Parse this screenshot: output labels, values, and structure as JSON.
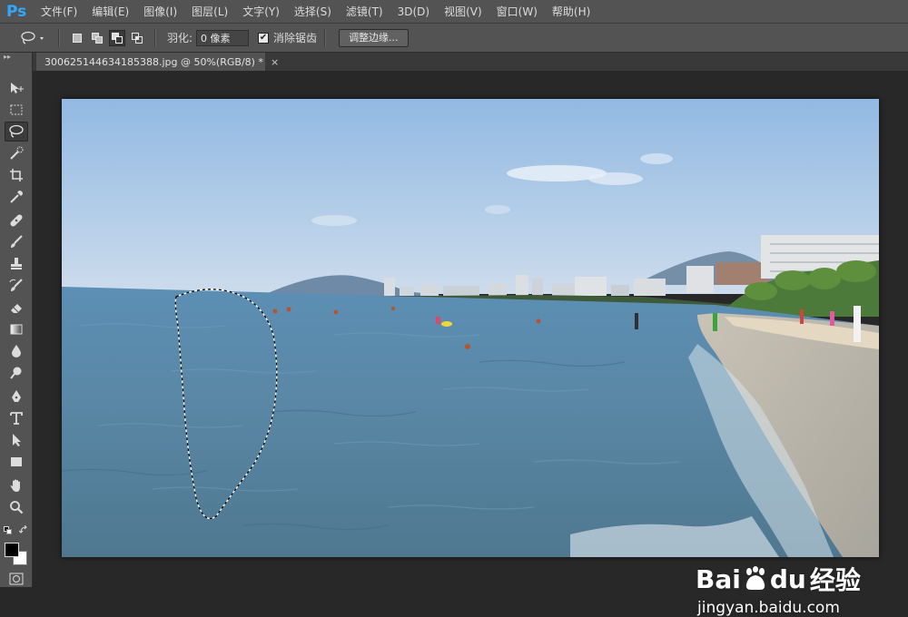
{
  "app": {
    "logo": "Ps"
  },
  "menu": [
    "文件(F)",
    "编辑(E)",
    "图像(I)",
    "图层(L)",
    "文字(Y)",
    "选择(S)",
    "滤镜(T)",
    "3D(D)",
    "视图(V)",
    "窗口(W)",
    "帮助(H)"
  ],
  "options": {
    "tool_icon": "lasso-icon",
    "feather_label": "羽化:",
    "feather_value": "0 像素",
    "antialias_checked": true,
    "antialias_label": "消除锯齿",
    "refine_edge_label": "调整边缘..."
  },
  "document": {
    "tab_title": "300625144634185388.jpg @ 50%(RGB/8) *",
    "close_glyph": "×"
  },
  "tools": [
    "move-tool",
    "marquee-tool",
    "lasso-tool",
    "quick-selection-tool",
    "crop-tool",
    "eyedropper-tool",
    "healing-brush-tool",
    "brush-tool",
    "clone-stamp-tool",
    "history-brush-tool",
    "eraser-tool",
    "gradient-tool",
    "blur-tool",
    "dodge-tool",
    "pen-tool",
    "type-tool",
    "path-selection-tool",
    "rectangle-tool",
    "hand-tool",
    "zoom-tool"
  ],
  "active_tool": "lasso-tool",
  "colors": {
    "foreground": "#000000",
    "background": "#ffffff",
    "accent": "#31a8ff"
  },
  "watermark": {
    "logo_a": "Bai",
    "logo_b": "du",
    "logo_c": "经验",
    "url": "jingyan.baidu.com"
  }
}
